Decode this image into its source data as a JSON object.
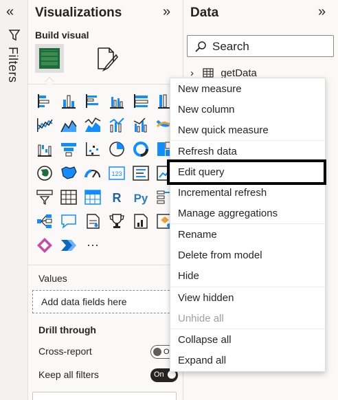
{
  "filters": {
    "label": "Filters"
  },
  "visualizations": {
    "title": "Visualizations",
    "build_label": "Build visual",
    "values_label": "Values",
    "add_field_placeholder": "Add data fields here",
    "drill_through_label": "Drill through",
    "cross_report_label": "Cross-report",
    "cross_report_toggle": "Of",
    "keep_filters_label": "Keep all filters",
    "keep_filters_toggle": "On",
    "more_glyph": "···"
  },
  "data_pane": {
    "title": "Data",
    "search_placeholder": "Search",
    "table_name": "getData"
  },
  "context_menu": {
    "items": [
      {
        "label": "New measure"
      },
      {
        "label": "New column"
      },
      {
        "label": "New quick measure"
      },
      {
        "label": "Refresh data"
      },
      {
        "label": "Edit query"
      },
      {
        "label": "Incremental refresh"
      },
      {
        "label": "Manage aggregations"
      },
      {
        "label": "Rename"
      },
      {
        "label": "Delete from model"
      },
      {
        "label": "Hide"
      },
      {
        "label": "View hidden"
      },
      {
        "label": "Unhide all"
      },
      {
        "label": "Collapse all"
      },
      {
        "label": "Expand all"
      }
    ],
    "highlighted_item": "Edit query"
  },
  "colors": {
    "accent": "#118dff",
    "dark": "#252423",
    "green": "#1e6c3b",
    "highlight_border": "#000000"
  }
}
